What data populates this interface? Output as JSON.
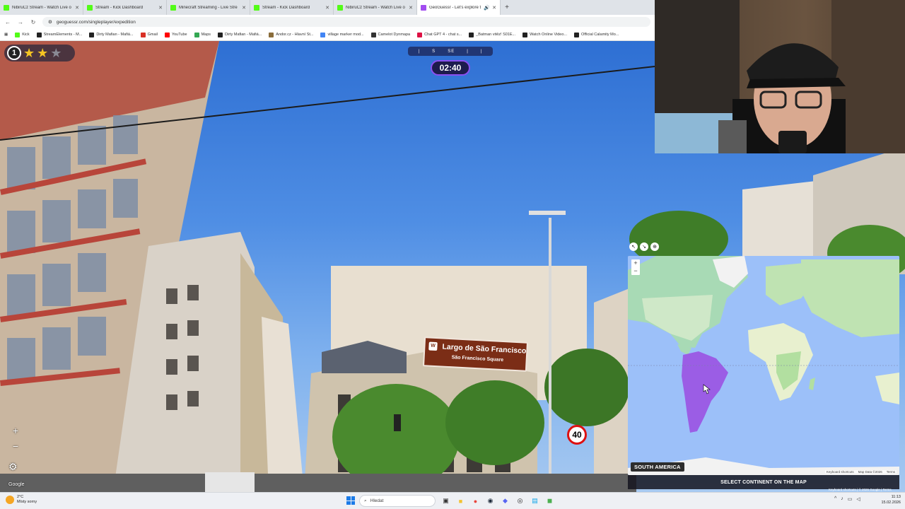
{
  "browser": {
    "tabs": [
      {
        "title": "NibiruCz Stream - Watch Live o",
        "favicon": "kick-icon",
        "color": "#53fc18",
        "active": false
      },
      {
        "title": "Stream - Kick Dashboard",
        "favicon": "kick-icon",
        "color": "#53fc18",
        "active": false
      },
      {
        "title": "Minecraft Streaming - Live Stre",
        "favicon": "kick-icon",
        "color": "#53fc18",
        "active": false
      },
      {
        "title": "Stream - Kick Dashboard",
        "favicon": "kick-icon",
        "color": "#53fc18",
        "active": false
      },
      {
        "title": "NibiruCz Stream - Watch Live o",
        "favicon": "kick-icon",
        "color": "#53fc18",
        "active": false
      },
      {
        "title": "GeoGuessr - Let's explore t",
        "favicon": "geoguessr-icon",
        "color": "#a24df0",
        "active": true
      }
    ],
    "url": "geoguessr.com/singleplayer/expedition",
    "bookmarks": [
      {
        "label": "Kick",
        "color": "#53fc18"
      },
      {
        "label": "StreamElements - M...",
        "color": "#222"
      },
      {
        "label": "Dirty Mafian - Mafiá...",
        "color": "#222"
      },
      {
        "label": "Gmail",
        "color": "#d93025"
      },
      {
        "label": "YouTube",
        "color": "#ff0000"
      },
      {
        "label": "Maps",
        "color": "#34a853"
      },
      {
        "label": "Dirty Mafian - Mafiá...",
        "color": "#222"
      },
      {
        "label": "Andor.cz - Hlavní St...",
        "color": "#8a6d3b"
      },
      {
        "label": "village marker mod...",
        "color": "#4285f4"
      },
      {
        "label": "Camelot Dynmapa",
        "color": "#333"
      },
      {
        "label": "Chat GPT 4 - chat s...",
        "color": "#d14"
      },
      {
        "label": "_Batman vitěz! S01E...",
        "color": "#222"
      },
      {
        "label": "Watch Online Video...",
        "color": "#222"
      },
      {
        "label": "Official Calamity Mo...",
        "color": "#222"
      }
    ]
  },
  "game": {
    "level_badge": "1",
    "stars_filled": 2,
    "stars_total": 3,
    "compass_letters": [
      "S",
      "SE"
    ],
    "timer": "02:40",
    "zoom_in": "+",
    "zoom_out": "−",
    "google_logo": "Google"
  },
  "scene": {
    "sign_line1": "Largo de São Francisco",
    "sign_line2": "São Francisco Square",
    "speed_limit": "40"
  },
  "map": {
    "hover_continent": "SOUTH AMERICA",
    "prompt": "SELECT CONTINENT ON THE MAP",
    "footer": [
      "Keyboard shortcuts",
      "Map Data ©2026",
      "Terms"
    ],
    "bottom_footer": "Keyboard shortcuts | © 2026 Google | Terms",
    "highlight_color": "#9b5de5"
  },
  "taskbar": {
    "weather_temp": "2°C",
    "weather_desc": "Místy sorny",
    "search_placeholder": "Hledat",
    "time": "11:13",
    "date": "15.02.2026"
  }
}
